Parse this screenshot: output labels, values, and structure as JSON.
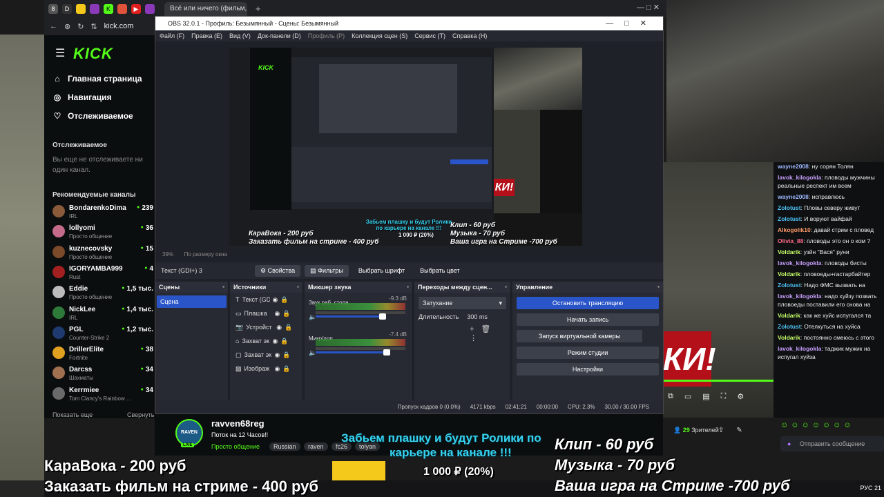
{
  "browser": {
    "tab_title": "Всё или ничего (фильм, 2",
    "new_tab": "+",
    "window_controls": "— □ ✕",
    "url": "kick.com"
  },
  "kick": {
    "logo": "KICK",
    "nav": [
      {
        "label": "Главная страница",
        "icon": "home-icon",
        "glyph": "⌂"
      },
      {
        "label": "Навигация",
        "icon": "compass-icon",
        "glyph": "◎"
      },
      {
        "label": "Отслеживаемое",
        "icon": "heart-icon",
        "glyph": "♡"
      }
    ],
    "following_heading": "Отслеживаемое",
    "following_note": "Вы еще не отслеживаете ни один канал.",
    "recommended_heading": "Рекомендуемые каналы",
    "channels": [
      {
        "name": "BondarenkoDima",
        "category": "IRL",
        "viewers": "239",
        "color": "#8a5a3a"
      },
      {
        "name": "lollyomi",
        "category": "Просто общение",
        "viewers": "36",
        "color": "#c46b8a"
      },
      {
        "name": "kuznecovsky",
        "category": "Просто общение",
        "viewers": "15",
        "color": "#7a4a2a"
      },
      {
        "name": "IGORYAMBA999",
        "category": "Rust",
        "viewers": "4",
        "color": "#a32020"
      },
      {
        "name": "Eddie",
        "category": "Просто общение",
        "viewers": "1,5 тыс.",
        "color": "#bbb"
      },
      {
        "name": "NickLee",
        "category": "IRL",
        "viewers": "1,4 тыс.",
        "color": "#2e7a3a"
      },
      {
        "name": "PGL",
        "category": "Counter-Strike 2",
        "viewers": "1,2 тыс.",
        "color": "#1e3a6e"
      },
      {
        "name": "DrillerElite",
        "category": "Fortnite",
        "viewers": "38",
        "color": "#e0a020"
      },
      {
        "name": "Darcss",
        "category": "Шахматы",
        "viewers": "34",
        "color": "#a07050"
      },
      {
        "name": "Kerrmiee",
        "category": "Tom Clancy's Rainbow ...",
        "viewers": "34",
        "color": "#6a6a6a"
      }
    ],
    "show_more": "Показать еще",
    "collapse": "Свернуть"
  },
  "obs": {
    "title": "OBS 32.0.1 - Профиль: Безымянный - Сцены: Безымянный",
    "menu": [
      "Файл (F)",
      "Правка (E)",
      "Вид (V)",
      "Док-панели (D)",
      "Профиль (P)",
      "Коллекция сцен (S)",
      "Сервис (T)",
      "Справка (H)"
    ],
    "zoom": "39%",
    "fit": "По размеру окна",
    "source_label": "Текст (GDI+) 3",
    "source_buttons": [
      "Свойства",
      "Фильтры",
      "Выбрать шрифт",
      "Выбрать цвет"
    ],
    "docks": {
      "scenes": "Сцены",
      "sources": "Источники",
      "mixer": "Микшер звука",
      "transitions": "Переходы между сцен...",
      "controls": "Управление"
    },
    "scene": "Сцена",
    "sources": [
      "Текст (GDI",
      "Плашка",
      "Устройст",
      "Захват эк",
      "Захват эк",
      "Изображ"
    ],
    "mixer": [
      {
        "name": "Звук раб. стола",
        "db": "-9.3 dB"
      },
      {
        "name": "Микр/доп",
        "db": "-7.4 dB"
      }
    ],
    "transition": "Затухание",
    "duration_label": "Длительность",
    "duration_value": "300 ms",
    "controls": [
      "Остановить трансляцию",
      "Начать запись",
      "Запуск виртуальной камеры",
      "Режим студии",
      "Настройки"
    ],
    "status": {
      "dropped": "Пропуск кадров 0 (0.0%)",
      "bitrate": "4171 kbps",
      "live_time": "02:41:21",
      "rec_time": "00:00:00",
      "cpu": "CPU: 2.3%",
      "fps": "30.00 / 30.00 FPS"
    }
  },
  "preview": {
    "kick": "KICK",
    "ki": "КИ!",
    "karaoke": "КараВока - 200 руб",
    "film": "Заказать фильм на стриме - 400 руб",
    "banner": "Забьем плашку и будут Ролики по карьере на канале !!!",
    "clip": "Клип - 60 руб",
    "music": "Музыка - 70 руб",
    "game": "Ваша игра на Стриме -700 руб",
    "goal": "1 000 ₽ (20%)"
  },
  "stream": {
    "streamer": "ravven68reg",
    "avatar": "RAVEN",
    "live": "LIVE",
    "title": "Поток на 12 Часов!!",
    "category": "Просто общение",
    "tags": [
      "Russian",
      "raven",
      "fc26",
      "tolyan"
    ],
    "viewers_count": "29",
    "viewers_label": "Зрителей"
  },
  "chat": {
    "messages": [
      {
        "user": "wayne2008",
        "text": "ну сорян Толян",
        "color": "#9fb8ff"
      },
      {
        "user": "lavok_kilogokla",
        "text": "пловоды мужчины реальные респект им всем",
        "color": "#c9a0ff"
      },
      {
        "user": "wayne2008",
        "text": "исправлюсь",
        "color": "#9fb8ff"
      },
      {
        "user": "Zolotust",
        "text": "Пловы северу живут",
        "color": "#4fc3f7"
      },
      {
        "user": "Zolotust",
        "text": "И воруют вайфай",
        "color": "#4fc3f7"
      },
      {
        "user": "Alkogolik10",
        "text": "давай стрим с пловед",
        "color": "#ff9a6a"
      },
      {
        "user": "Olivia_88",
        "text": "пловоды это он о ком ?",
        "color": "#ff6a8a"
      },
      {
        "user": "Voldarik",
        "text": "узйн \"Вася\" руни",
        "color": "#c9ff6a"
      },
      {
        "user": "lavok_kilogokla",
        "text": "пловоды бисты",
        "color": "#c9a0ff"
      },
      {
        "user": "Voldarik",
        "text": "пловоеды+гастарбайтер",
        "color": "#c9ff6a"
      },
      {
        "user": "Zolotust",
        "text": "Надо ФМС вызвать на",
        "color": "#4fc3f7"
      },
      {
        "user": "lavok_kilogokla",
        "text": "надо хуйзу позвать пловоеды поставили его снова на",
        "color": "#c9a0ff"
      },
      {
        "user": "Voldarik",
        "text": "как же хуйс испугался та",
        "color": "#c9ff6a"
      },
      {
        "user": "Zolotust",
        "text": "Отелкуться на хуйса",
        "color": "#4fc3f7"
      },
      {
        "user": "Voldarik",
        "text": "постоянно смеюсь с этого",
        "color": "#c9ff6a"
      },
      {
        "user": "lavok_kilogokla",
        "text": "таджик мужик на испугал хуйза",
        "color": "#c9a0ff"
      }
    ],
    "send_placeholder": "Отправить сообщение"
  },
  "overlay": {
    "banner": "Забьем плашку и будут Ролики по карьере на канале !!!",
    "karaoke": "КараВока - 200 руб",
    "film": "Заказать фильм на стриме - 400 руб",
    "clip": "Клип - 60 руб",
    "music": "Музыка - 70 руб",
    "game": "Ваша игра на Стриме -700 руб",
    "goal": "1 000 ₽ (20%)",
    "lang": "РУС",
    "clock": "21"
  }
}
